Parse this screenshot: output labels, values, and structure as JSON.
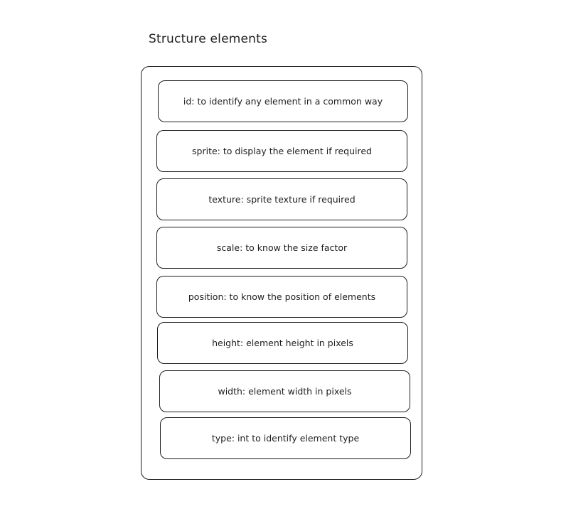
{
  "diagram": {
    "title": "Structure elements",
    "fields": [
      "id: to identify any element in a common way",
      "sprite: to display the element if required",
      "texture: sprite texture if required",
      "scale: to know the size factor",
      "position: to know the position of elements",
      "height: element height in pixels",
      "width: element width in pixels",
      "type: int to identify element type"
    ]
  },
  "colors": {
    "stroke": "#1e1e1e",
    "background": "#ffffff"
  }
}
